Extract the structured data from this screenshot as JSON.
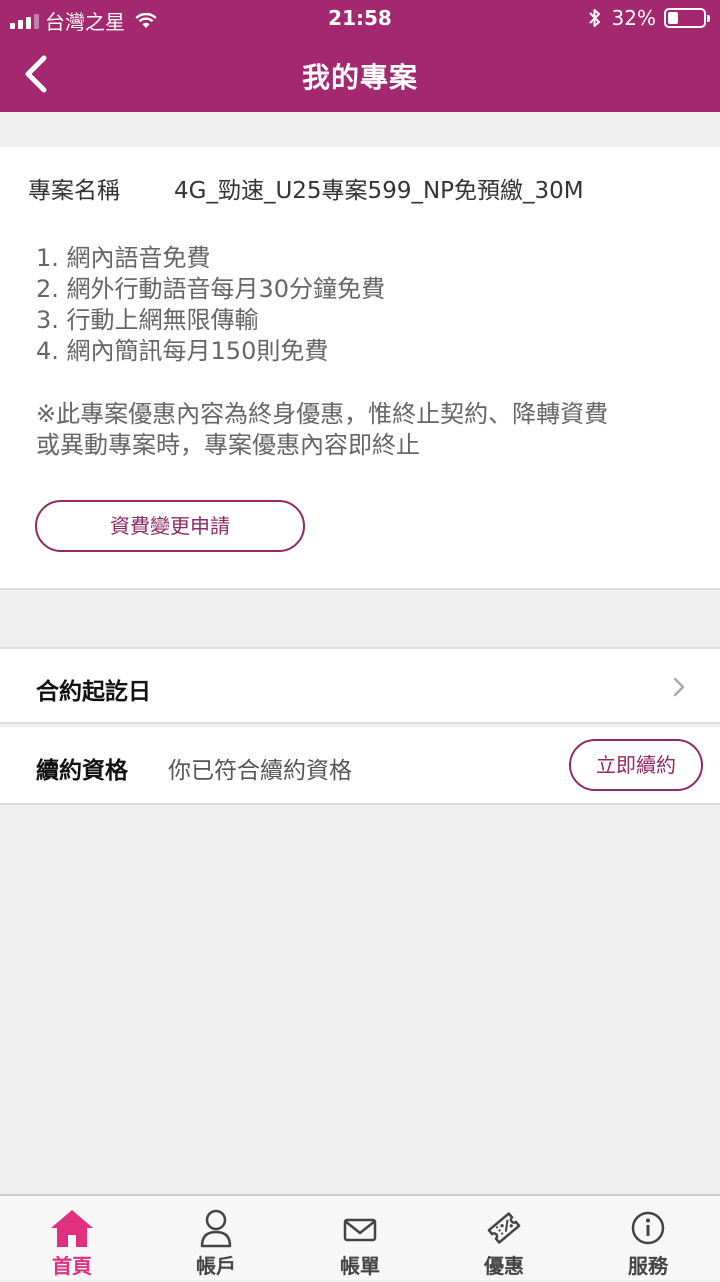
{
  "status_bar": {
    "carrier": "台灣之星",
    "time": "21:58",
    "battery": "32%"
  },
  "header": {
    "title": "我的專案",
    "back_icon": "chevron-left-icon"
  },
  "plan": {
    "name_label": "專案名稱",
    "name_value": "4G_勁速_U25專案599_NP免預繳_30M",
    "features": [
      "1. 網內語音免費",
      "2. 網外行動語音每月30分鐘免費",
      "3. 行動上網無限傳輸",
      "4. 網內簡訊每月150則免費"
    ],
    "note_line1": "※此專案優惠內容為終身優惠，惟終止契約、降轉資費",
    "note_line2": "或異動專案時，專案優惠內容即終止",
    "change_button": "資費變更申請"
  },
  "contract": {
    "period_label": "合約起訖日",
    "renew_label": "續約資格",
    "renew_value": "你已符合續約資格",
    "renew_button": "立即續約"
  },
  "tabs": [
    {
      "label": "首頁",
      "icon": "home-icon",
      "active": true
    },
    {
      "label": "帳戶",
      "icon": "user-icon",
      "active": false
    },
    {
      "label": "帳單",
      "icon": "mail-icon",
      "active": false
    },
    {
      "label": "優惠",
      "icon": "coupon-icon",
      "active": false
    },
    {
      "label": "服務",
      "icon": "info-icon",
      "active": false
    }
  ],
  "colors": {
    "brand": "#a4286f",
    "button_border": "#8f2a66",
    "active_tab": "#e0307f"
  }
}
